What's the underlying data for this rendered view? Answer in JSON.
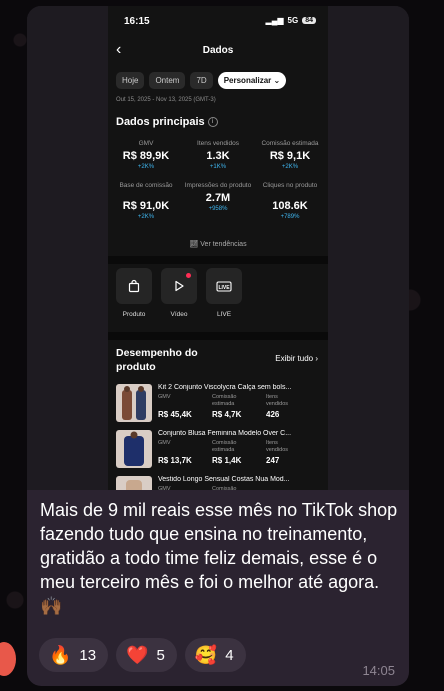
{
  "status": {
    "time": "16:15",
    "network": "5G",
    "battery": "84"
  },
  "header": {
    "back_glyph": "‹",
    "title": "Dados"
  },
  "chips": [
    "Hoje",
    "Ontem",
    "7D",
    "Personalizar"
  ],
  "chip_caret": "⌄",
  "date_range": "Out 15, 2025 - Nov 13, 2025 (GMT-3)",
  "main_data": {
    "title": "Dados principais",
    "info_glyph": "i",
    "metrics": [
      {
        "label": "GMV",
        "value": "R$ 89,9K",
        "change": "+2K%"
      },
      {
        "label": "Itens vendidos",
        "value": "1.3K",
        "change": "+1K%"
      },
      {
        "label": "Comissão estimada",
        "value": "R$ 9,1K",
        "change": "+2K%"
      },
      {
        "label": "Base de comissão",
        "value": "R$ 91,0K",
        "change": "+2K%"
      },
      {
        "label": "Impressões do produto",
        "value": "2.7M",
        "change": "+958%"
      },
      {
        "label": "Cliques no produto",
        "value": "108.6K",
        "change": "+789%"
      }
    ],
    "trends_link": "Ver tendências"
  },
  "quick_actions": [
    {
      "label": "Produto",
      "icon": "shopping-bag-icon"
    },
    {
      "label": "Vídeo",
      "icon": "play-icon"
    },
    {
      "label": "LIVE",
      "icon": "live-icon"
    }
  ],
  "performance": {
    "title": "Desempenho do produto",
    "see_all": "Exibir tudo",
    "columns": [
      "GMV",
      "Comissão estimada",
      "Itens vendidos"
    ],
    "products": [
      {
        "name": "Kit 2 Conjunto Viscolycra Calça sem bols...",
        "gmv": "R$ 45,4K",
        "commission": "R$ 4,7K",
        "items": "426"
      },
      {
        "name": "Conjunto Blusa Feminina Modelo Over C...",
        "gmv": "R$ 13,7K",
        "commission": "R$ 1,4K",
        "items": "247"
      },
      {
        "name": "Vestido Longo Sensual Costas Nua Mod...",
        "gmv": "",
        "commission": "",
        "items": ""
      }
    ]
  },
  "message": {
    "text": "Mais de 9 mil reais esse mês no TikTok shop fazendo tudo que ensina no treinamento, gratidão a todo time feliz demais, esse é o meu terceiro mês e foi o melhor até agora. 🙌🏾",
    "time": "14:05"
  },
  "reactions": [
    {
      "emoji": "🔥",
      "count": "13"
    },
    {
      "emoji": "❤️",
      "count": "5"
    },
    {
      "emoji": "🥰",
      "count": "4"
    }
  ],
  "colors": {
    "accent_blue": "#3fb6f0",
    "bubble": "#2b2330",
    "live_dot": "#ff2d55"
  }
}
